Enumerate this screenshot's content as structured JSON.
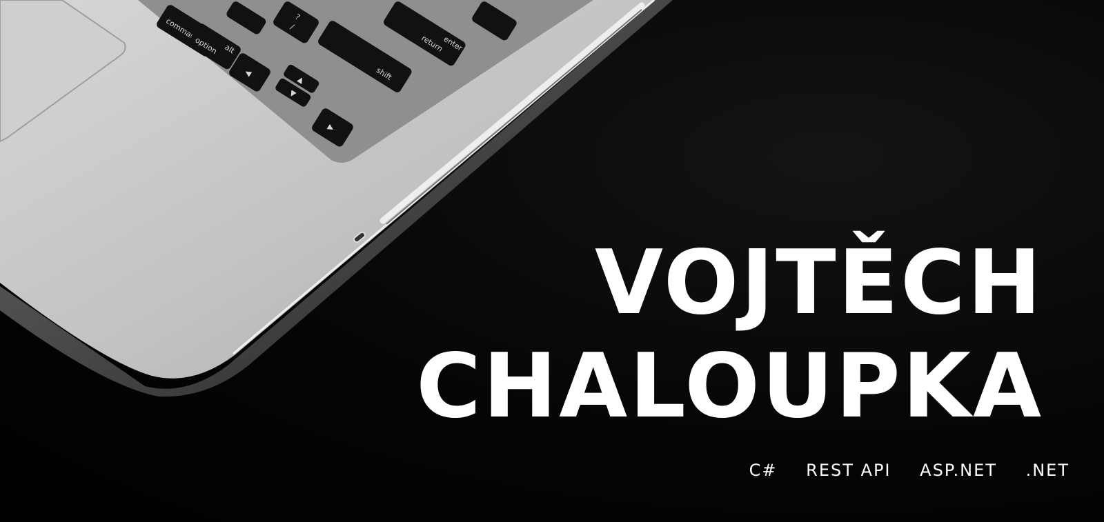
{
  "headline": {
    "first_name": "VOJTĚCH",
    "last_name": "CHALOUPKA"
  },
  "tags": [
    "C#",
    "REST API",
    "ASP.NET",
    ".NET"
  ],
  "laptop_keys": {
    "command": "command",
    "option": "option",
    "alt": "alt",
    "return": "return",
    "enter": "enter",
    "shift": "shift",
    "question": "?",
    "slash": "/"
  },
  "colors": {
    "background": "#000000",
    "text": "#ffffff",
    "laptop_body": "#bdbdbd",
    "key": "#111111"
  }
}
